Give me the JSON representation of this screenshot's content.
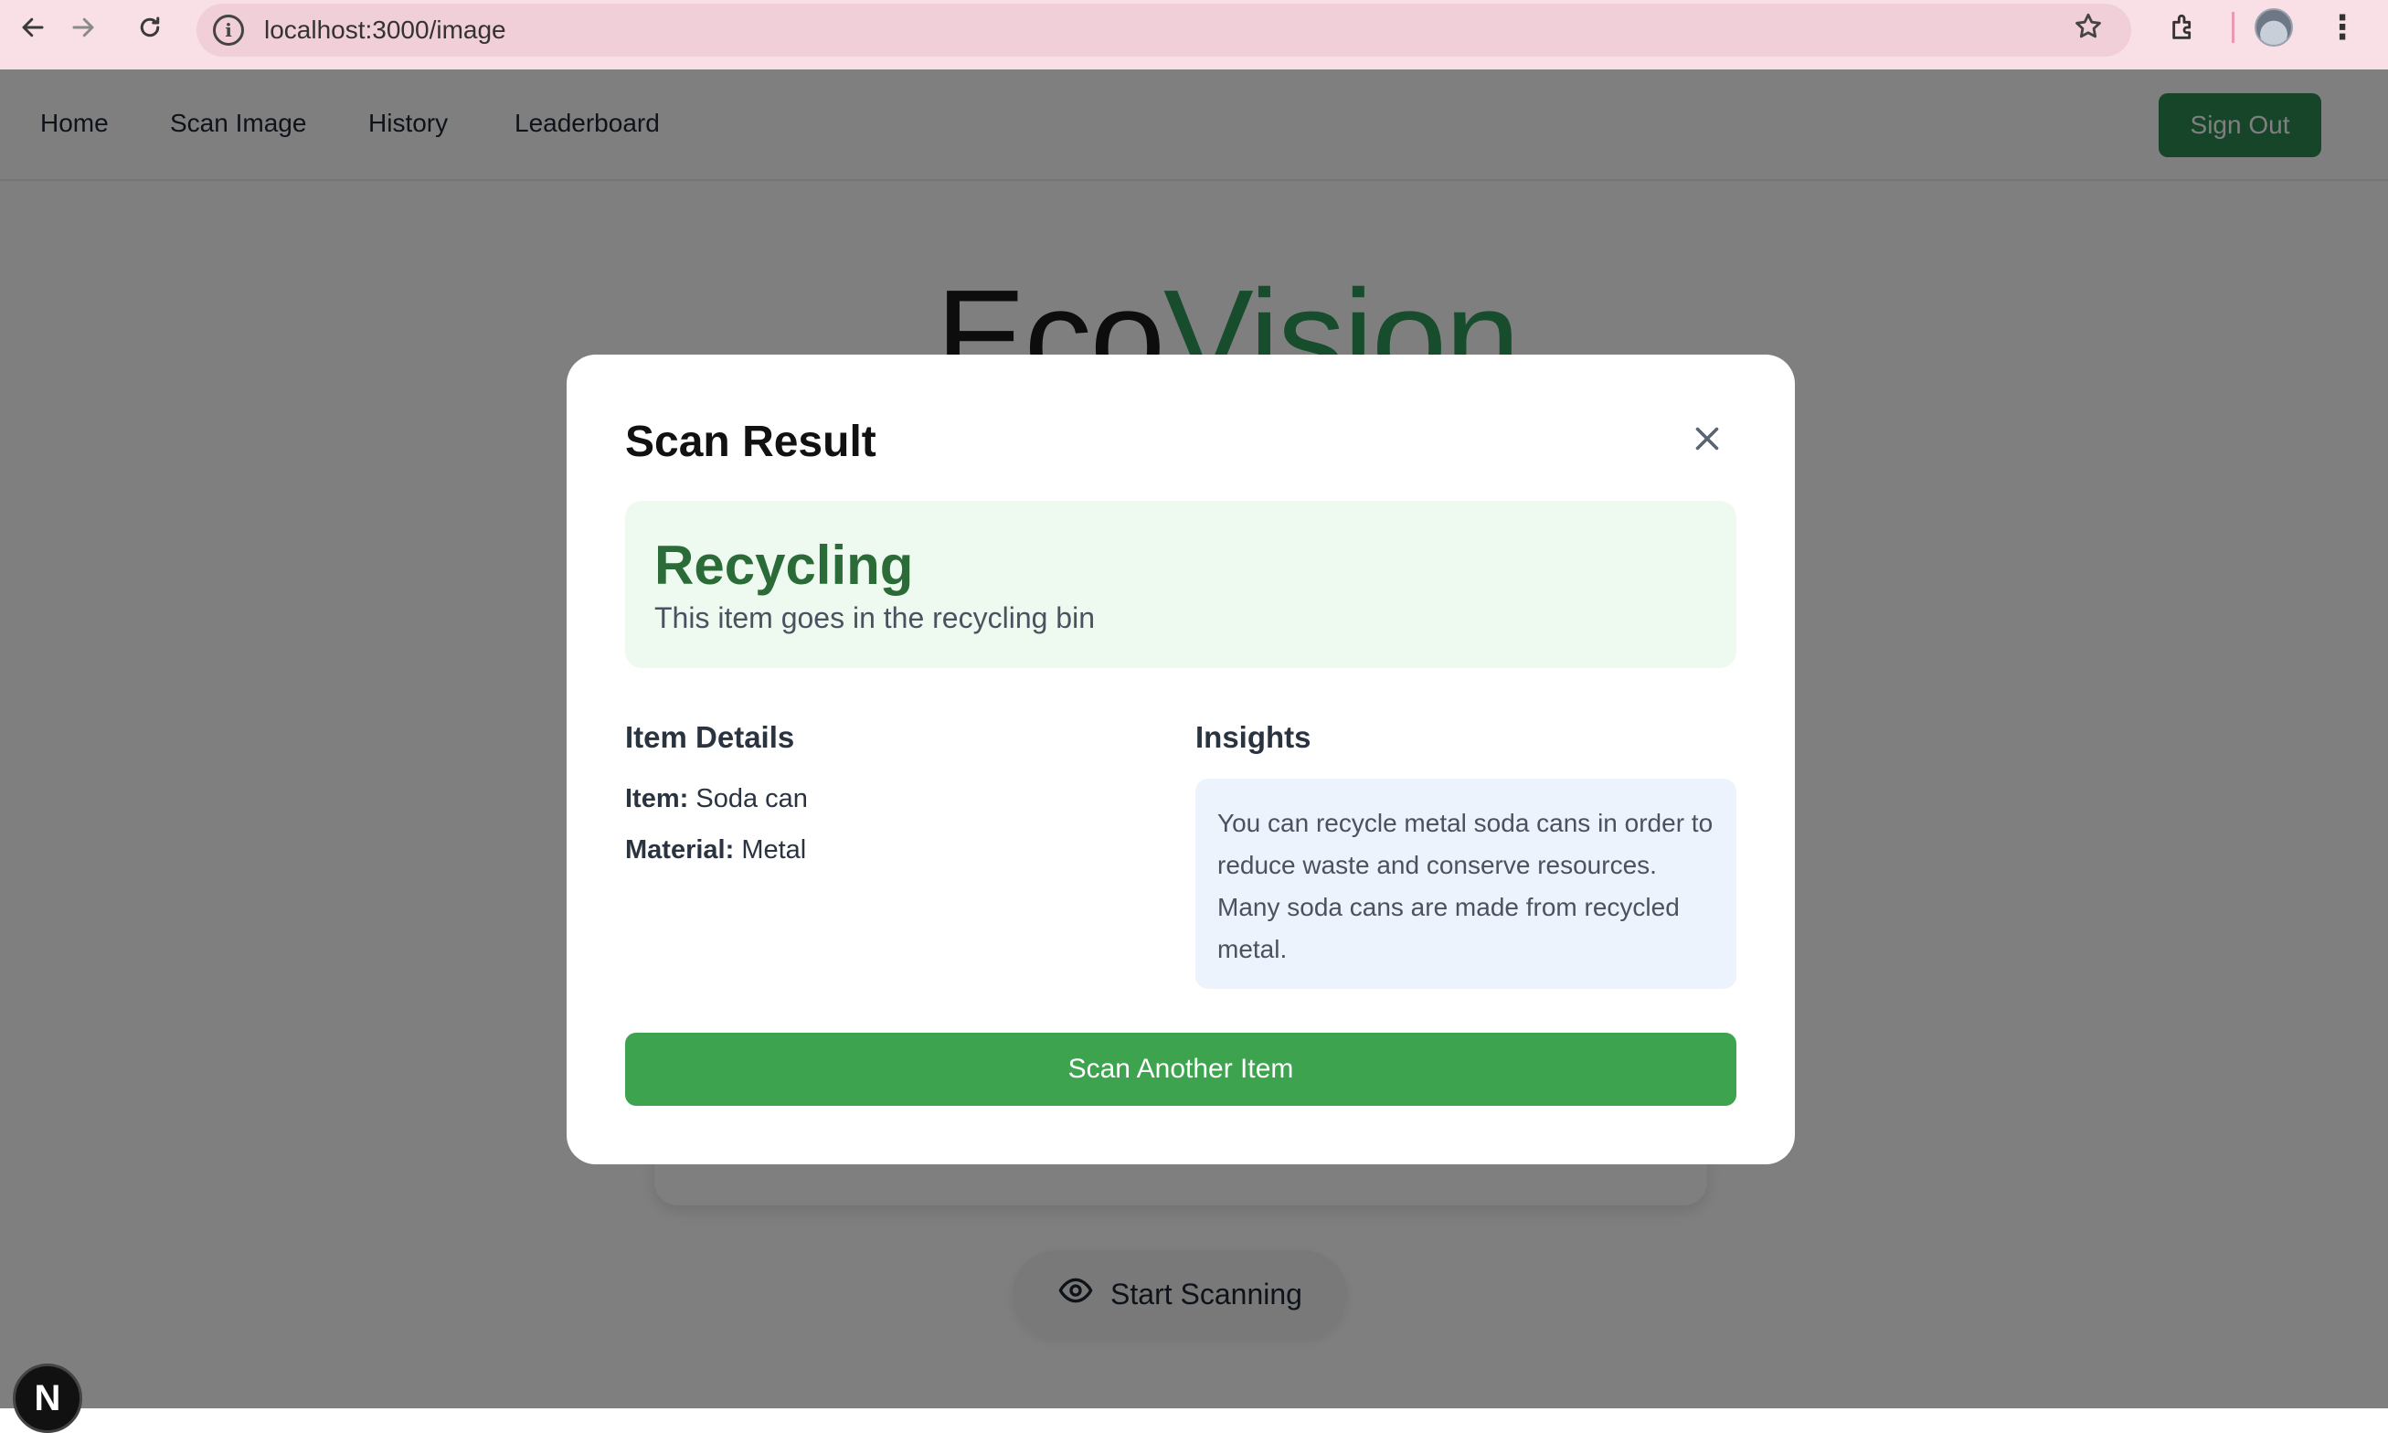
{
  "browser": {
    "url": "localhost:3000/image",
    "icons": [
      "back-arrow-icon",
      "forward-arrow-icon",
      "reload-icon",
      "site-info-icon",
      "bookmark-star-icon",
      "extensions-icon",
      "profile-avatar",
      "more-menu-icon"
    ]
  },
  "nav": {
    "items": [
      {
        "label": "Home"
      },
      {
        "label": "Scan Image"
      },
      {
        "label": "History"
      },
      {
        "label": "Leaderboard"
      }
    ],
    "signout_label": "Sign Out",
    "accent": "#2f8a52"
  },
  "brand": {
    "part1": "Eco",
    "part2": "Vision"
  },
  "start_button_label": "Start Scanning",
  "next_badge": "N",
  "modal": {
    "title": "Scan Result",
    "category": "Recycling",
    "category_desc": "This item goes in the recycling bin",
    "details_heading": "Item Details",
    "item_label": "Item:",
    "item_value": "Soda can",
    "material_label": "Material:",
    "material_value": "Metal",
    "insights_heading": "Insights",
    "insight_text": "You can recycle metal soda cans in order to reduce waste and conserve resources. Many soda cans are made from recycled metal.",
    "scan_again_label": "Scan Another Item",
    "colors": {
      "category": "#2b6b37",
      "result_bg": "#eefaf0",
      "insight_bg": "#edf3fd",
      "button": "#3ea34e"
    }
  }
}
